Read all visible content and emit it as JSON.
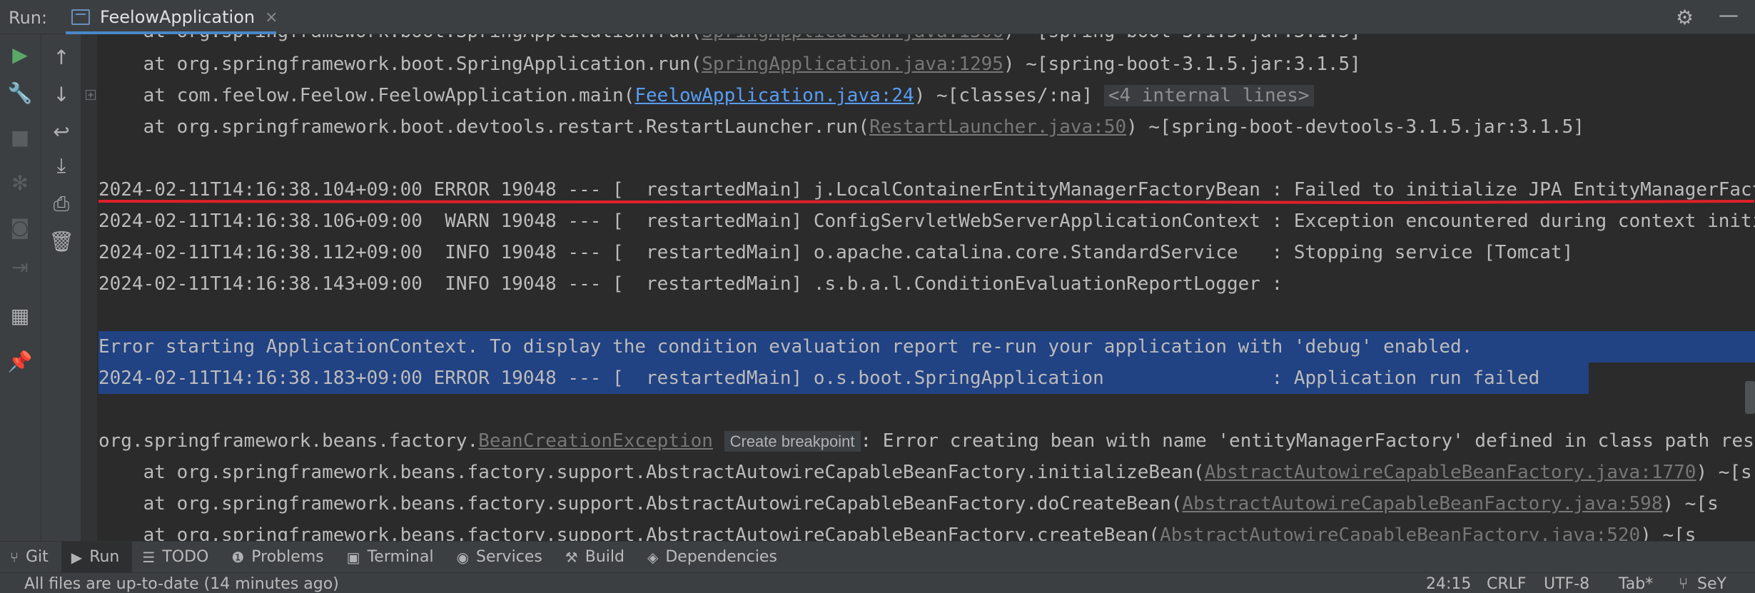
{
  "header": {
    "run_label": "Run:",
    "tab_title": "FeelowApplication",
    "close_glyph": "×",
    "settings_icon": "gear-icon",
    "minimize_icon": "minus-icon"
  },
  "console": {
    "stack_lines": [
      {
        "prefix": "    at org.springframework.boot.SpringApplication.run(",
        "link": "SpringApplication.java:1295",
        "suffix": ") ~[spring-boot-3.1.5.jar:3.1.5]"
      },
      {
        "prefix": "    at com.feelow.Feelow.FeelowApplication.main(",
        "link": "FeelowApplication.java:24",
        "suffix": ") ~[classes/:na] ",
        "hint": "<4 internal lines>"
      },
      {
        "prefix": "    at org.springframework.boot.devtools.restart.RestartLauncher.run(",
        "link": "RestartLauncher.java:50",
        "suffix": ") ~[spring-boot-devtools-3.1.5.jar:3.1.5]"
      }
    ],
    "log_lines": [
      "2024-02-11T14:16:38.104+09:00 ERROR 19048 --- [  restartedMain] j.LocalContainerEntityManagerFactoryBean : Failed to initialize JPA EntityManagerFactory",
      "2024-02-11T14:16:38.106+09:00  WARN 19048 --- [  restartedMain] ConfigServletWebServerApplicationContext : Exception encountered during context initialization",
      "2024-02-11T14:16:38.112+09:00  INFO 19048 --- [  restartedMain] o.apache.catalina.core.StandardService   : Stopping service [Tomcat]",
      "2024-02-11T14:16:38.143+09:00  INFO 19048 --- [  restartedMain] .s.b.a.l.ConditionEvaluationReportLogger :"
    ],
    "selected_lines": [
      "Error starting ApplicationContext. To display the condition evaluation report re-run your application with 'debug' enabled.",
      "2024-02-11T14:16:38.183+09:00 ERROR 19048 --- [  restartedMain] o.s.boot.SpringApplication               : Application run failed"
    ],
    "exception": {
      "prefix": "org.springframework.beans.factory.",
      "link": "BeanCreationException",
      "breakpoint_label": "Create breakpoint",
      "suffix": ": Error creating bean with name 'entityManagerFactory' defined in class path resource"
    },
    "trace_lines": [
      {
        "prefix": "    at org.springframework.beans.factory.support.AbstractAutowireCapableBeanFactory.initializeBean(",
        "link": "AbstractAutowireCapableBeanFactory.java:1770",
        "suffix": ") ~[s"
      },
      {
        "prefix": "    at org.springframework.beans.factory.support.AbstractAutowireCapableBeanFactory.doCreateBean(",
        "link": "AbstractAutowireCapableBeanFactory.java:598",
        "suffix": ") ~[s"
      },
      {
        "prefix": "    at org.springframework.beans.factory.support.AbstractAutowireCapableBeanFactory.createBean(",
        "link": "AbstractAutowireCapableBeanFactory.java:520",
        "suffix": ") ~[s"
      }
    ],
    "annotation_color": "#e0202a"
  },
  "bottom_tabs": [
    {
      "label": "Git",
      "icon": "git-branch-icon",
      "active": false
    },
    {
      "label": "Run",
      "icon": "play-icon",
      "active": true
    },
    {
      "label": "TODO",
      "icon": "list-icon",
      "active": false
    },
    {
      "label": "Problems",
      "icon": "info-icon",
      "active": false
    },
    {
      "label": "Terminal",
      "icon": "terminal-icon",
      "active": false
    },
    {
      "label": "Services",
      "icon": "services-icon",
      "active": false
    },
    {
      "label": "Build",
      "icon": "hammer-icon",
      "active": false
    },
    {
      "label": "Dependencies",
      "icon": "layers-icon",
      "active": false
    }
  ],
  "status": {
    "message": "All files are up-to-date (14 minutes ago)",
    "position": "24:15",
    "line_separator": "CRLF",
    "encoding": "UTF-8",
    "indent": "Tab*",
    "vcs": "SeY"
  }
}
